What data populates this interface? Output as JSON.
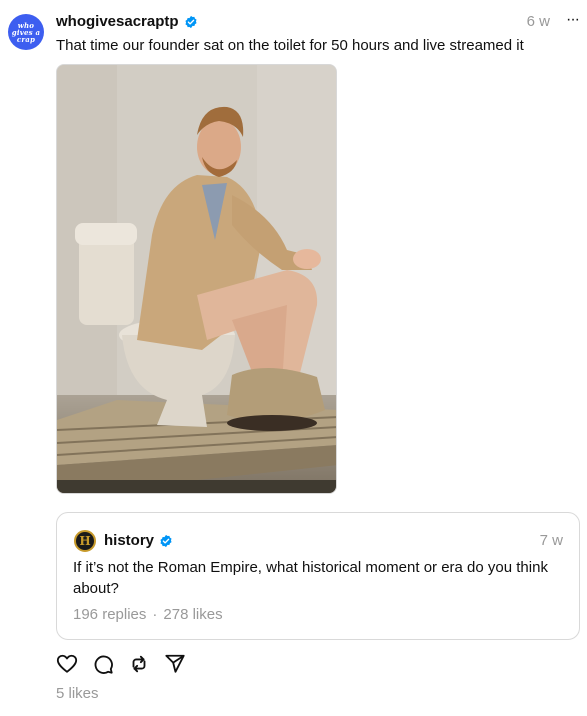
{
  "post": {
    "author": {
      "avatar_text": "who gives a crap",
      "username": "whogivesacraptp",
      "verified": true
    },
    "time": "6 w",
    "more_label": "···",
    "text": "That time our founder sat on the toilet for 50 hours and live streamed it",
    "media": {
      "type": "image"
    },
    "quote": {
      "author": {
        "avatar_text": "H",
        "username": "history",
        "verified": true
      },
      "time": "7 w",
      "text": "If it’s not the Roman Empire, what historical moment or era do you think about?",
      "replies": "196 replies",
      "separator": "·",
      "likes": "278 likes"
    },
    "actions": [
      {
        "icon": "heart-icon"
      },
      {
        "icon": "comment-icon"
      },
      {
        "icon": "repost-icon"
      },
      {
        "icon": "share-icon"
      }
    ],
    "likes": "5 likes"
  },
  "colors": {
    "verified": "#0095f6",
    "avatar_bg": "#3d5ef0",
    "muted": "#999999"
  }
}
